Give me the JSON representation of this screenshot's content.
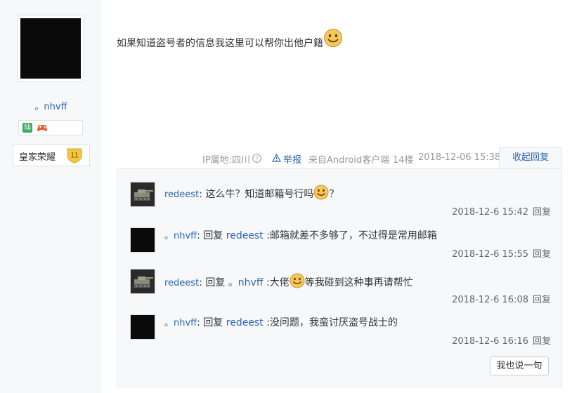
{
  "author": {
    "username": "。nhvff",
    "badge_xian": "仙",
    "rank_name": "皇家荣耀",
    "rank_level": "11"
  },
  "post": {
    "text": "如果知道盗号者的信息我这里可以帮你出他户籍",
    "emoji": "smile-emoji"
  },
  "meta": {
    "ip_location": "IP属地:四川",
    "help_icon": "question-circle-icon",
    "report_label": "举报",
    "client": "来自Android客户端",
    "floor": "14楼",
    "timestamp": "2018-12-06 15:38",
    "collapse_label": "收起回复"
  },
  "comments": [
    {
      "user": "redeest",
      "parts": [
        "这么牛？知道邮箱号行吗",
        "？"
      ],
      "time": "2018-12-6 15:42",
      "reply_label": "回复"
    },
    {
      "user": "。nhvff",
      "reply_prefix": "回复",
      "reply_to": "redeest",
      "text": ":邮箱就差不多够了，不过得是常用邮箱",
      "time": "2018-12-6 15:55",
      "reply_label": "回复"
    },
    {
      "user": "redeest",
      "reply_prefix": "回复",
      "reply_to": "。nhvff",
      "parts": [
        ":大佬",
        "等我碰到这种事再请帮忙"
      ],
      "time": "2018-12-6 16:08",
      "reply_label": "回复"
    },
    {
      "user": "。nhvff",
      "reply_prefix": "回复",
      "reply_to": "redeest",
      "text": ":没问题，我蛮讨厌盗号战士的",
      "time": "2018-12-6 16:16",
      "reply_label": "回复"
    }
  ],
  "say_button": "我也说一句",
  "colors": {
    "link": "#2d64b3",
    "sidebar_bg": "#f7f8fa",
    "badge_green": "#3eab63"
  }
}
